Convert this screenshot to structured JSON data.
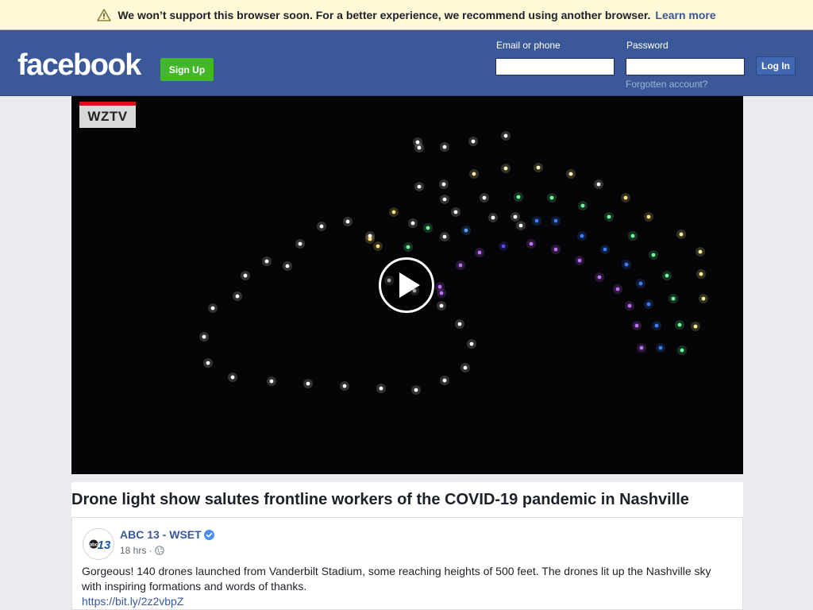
{
  "banner": {
    "message": "We won’t support this browser soon. For a better experience, we recommend using another browser.",
    "link": "Learn more",
    "icon": "warning-icon"
  },
  "header": {
    "logo": "facebook",
    "signup_label": "Sign Up",
    "email_label": "Email or phone",
    "email_value": "",
    "password_label": "Password",
    "password_value": "",
    "login_label": "Log In",
    "forgot_label": "Forgotten account?"
  },
  "video": {
    "watermark": "WZTV",
    "play_icon": "play-icon"
  },
  "post": {
    "title": "Drone light show salutes frontline workers of the COVID-19 pandemic in Nashville",
    "page_name": "ABC 13 - WSET",
    "timestamp": "18 hrs ·",
    "body": "Gorgeous! 140 drones launched from Vanderbilt Stadium, some reaching heights of 500 feet. The drones lit up the Nashville sky with inspiring formations and words of thanks.",
    "link": "https://bit.ly/2z2vbpZ",
    "avatar_text": "abc13"
  },
  "colors": {
    "brand_blue": "#3b5998",
    "signup_green": "#42b72a",
    "banner_yellow": "#fff9d7",
    "link_blue": "#385898"
  }
}
